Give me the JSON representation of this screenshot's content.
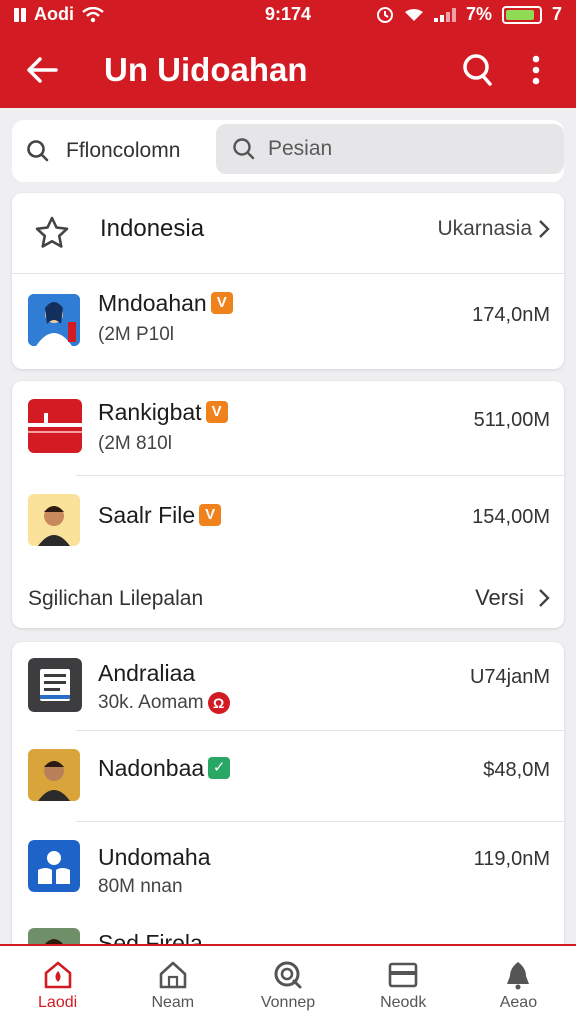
{
  "status": {
    "carrier": "Aodi",
    "time": "9:174",
    "battery": "7%",
    "extra": "7"
  },
  "appbar": {
    "title": "Un Uidoahan"
  },
  "search": {
    "tab_label": "Ffloncolomn",
    "placeholder": "Pesian"
  },
  "colors": {
    "brand": "#d31b24",
    "accent_orange": "#f0821e",
    "accent_green": "#29a865"
  },
  "section1": {
    "header": {
      "title": "Indonesia",
      "action": "Ukarnasia"
    },
    "items": [
      {
        "name": "Mndoahan",
        "badge": "V",
        "sub": "(2M P10l",
        "amount": "174,0nM",
        "icon": "person-blue-icon"
      }
    ]
  },
  "section2": {
    "items": [
      {
        "name": "Rankigbat",
        "badge": "V",
        "sub": "(2M 810l",
        "amount": "511,00M",
        "icon": "flag-red-icon"
      },
      {
        "name": "Saalr File",
        "badge": "V",
        "sub": "",
        "amount": "154,00M",
        "icon": "person-yellow-icon"
      }
    ],
    "footer": {
      "label": "Sgilichan Lilepalan",
      "action": "Versi"
    }
  },
  "section3": {
    "items": [
      {
        "name": "Andraliaa",
        "sub": "30k. Aomam",
        "sub_badge": "Ω",
        "amount": "U74janM",
        "icon": "document-icon"
      },
      {
        "name": "Nadonbaa",
        "badge": "✓",
        "sub": "",
        "amount": "$48,0M",
        "icon": "person-mustard-icon"
      },
      {
        "name": "Undomaha",
        "sub": "80M nnan",
        "amount": "119,0nM",
        "icon": "people-blue-icon"
      },
      {
        "name": "Sed Firela",
        "sub": "",
        "amount": "",
        "icon": "person-green-icon"
      }
    ]
  },
  "bottom_nav": [
    {
      "label": "Laodi",
      "icon": "home-icon",
      "active": true
    },
    {
      "label": "Neam",
      "icon": "house-outline-icon",
      "active": false
    },
    {
      "label": "Vonnep",
      "icon": "search-circle-icon",
      "active": false
    },
    {
      "label": "Neodk",
      "icon": "wallet-icon",
      "active": false
    },
    {
      "label": "Aeao",
      "icon": "bell-icon",
      "active": false
    }
  ]
}
